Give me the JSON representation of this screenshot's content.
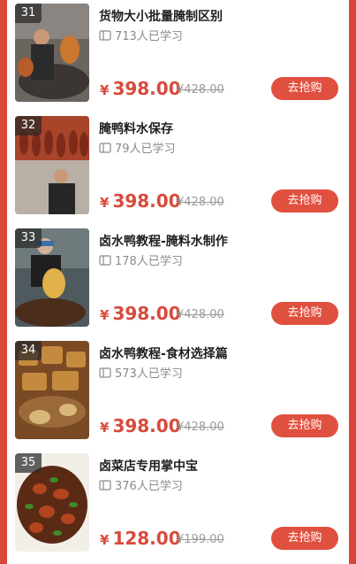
{
  "courses": [
    {
      "index": "31",
      "title": "货物大小批量腌制区别",
      "learners": "713人已学习",
      "currency": "¥",
      "price": "398.00",
      "original_price": "¥428.00",
      "button": "去抢购"
    },
    {
      "index": "32",
      "title": "腌鸭料水保存",
      "learners": "79人已学习",
      "currency": "¥",
      "price": "398.00",
      "original_price": "¥428.00",
      "button": "去抢购"
    },
    {
      "index": "33",
      "title": "卤水鸭教程-腌料水制作",
      "learners": "178人已学习",
      "currency": "¥",
      "price": "398.00",
      "original_price": "¥428.00",
      "button": "去抢购"
    },
    {
      "index": "34",
      "title": "卤水鸭教程-食材选择篇",
      "learners": "573人已学习",
      "currency": "¥",
      "price": "398.00",
      "original_price": "¥428.00",
      "button": "去抢购"
    },
    {
      "index": "35",
      "title": "卤菜店专用掌中宝",
      "learners": "376人已学习",
      "currency": "¥",
      "price": "128.00",
      "original_price": "¥199.00",
      "button": "去抢购"
    }
  ],
  "colors": {
    "accent": "#e0503f",
    "price": "#d84a3c",
    "background": "#d9463a"
  },
  "icons": {
    "learners": "book-icon"
  }
}
